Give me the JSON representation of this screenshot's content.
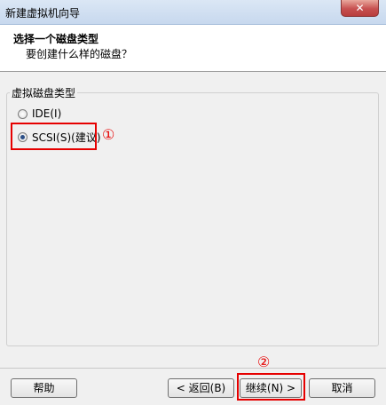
{
  "window": {
    "title": "新建虚拟机向导",
    "close_glyph": "✕"
  },
  "header": {
    "title": "选择一个磁盘类型",
    "subtitle": "要创建什么样的磁盘？"
  },
  "group": {
    "legend": "虚拟磁盘类型",
    "options": [
      {
        "label": "IDE(I)",
        "selected": false
      },
      {
        "label": "SCSI(S)(建议)",
        "selected": true
      }
    ]
  },
  "annotations": {
    "one": "①",
    "two": "②",
    "color": "#e60000"
  },
  "buttons": {
    "help": "帮助",
    "back": "< 返回(B)",
    "next": "继续(N) >",
    "cancel": "取消"
  }
}
